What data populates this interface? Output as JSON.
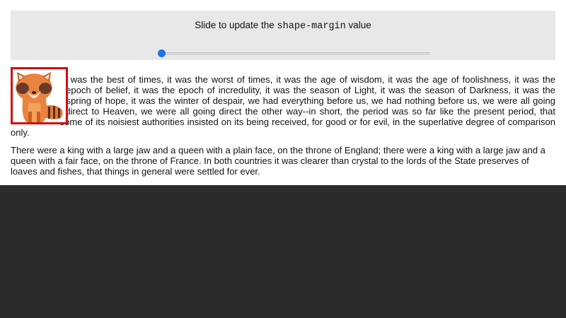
{
  "controls": {
    "label_prefix": "Slide to update the",
    "label_code": "shape-margin",
    "label_suffix": "value",
    "slider_value": 0,
    "accent_color": "#1a73e8"
  },
  "image": {
    "icon": "red-panda-icon",
    "border_color": "#d40d0d"
  },
  "paragraphs": [
    "It was the best of times, it was the worst of times, it was the age of wisdom, it was the age of foolishness, it was the epoch of belief, it was the epoch of incredulity, it was the season of Light, it was the season of Darkness, it was the spring of hope, it was the winter of despair, we had everything before us, we had nothing before us, we were all going direct to Heaven, we were all going direct the other way--in short, the period was so far like the present period, that some of its noisiest authorities insisted on its being received, for good or for evil, in the superlative degree of comparison only.",
    "There were a king with a large jaw and a queen with a plain face, on the throne of England; there were a king with a large jaw and a queen with a fair face, on the throne of France. In both countries it was clearer than crystal to the lords of the State preserves of loaves and fishes, that things in general were settled for ever."
  ]
}
